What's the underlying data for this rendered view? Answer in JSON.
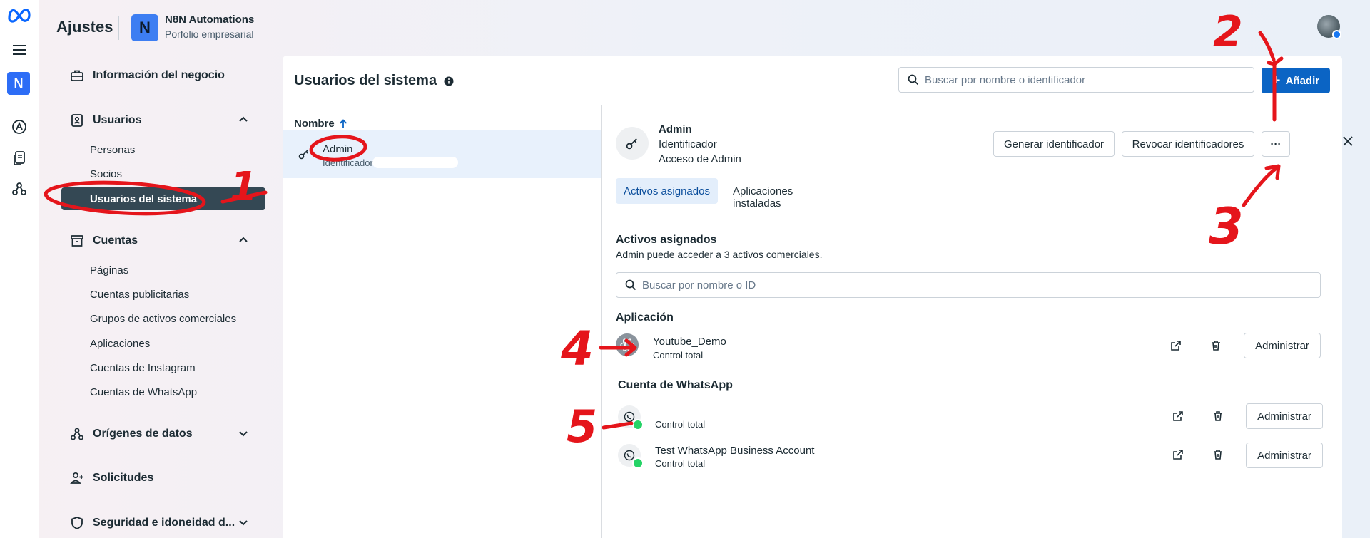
{
  "header": {
    "title": "Ajustes",
    "org_initial": "N",
    "org_name": "N8N Automations",
    "org_subtitle": "Porfolio empresarial"
  },
  "rail": {
    "org_initial": "N"
  },
  "nav": {
    "business_info": "Información del negocio",
    "users_section": "Usuarios",
    "users_items": [
      "Personas",
      "Socios",
      "Usuarios del sistema"
    ],
    "accounts_section": "Cuentas",
    "accounts_items": [
      "Páginas",
      "Cuentas publicitarias",
      "Grupos de activos comerciales",
      "Aplicaciones",
      "Cuentas de Instagram",
      "Cuentas de WhatsApp"
    ],
    "data_sources": "Orígenes de datos",
    "requests": "Solicitudes",
    "security": "Seguridad e idoneidad d..."
  },
  "main": {
    "title": "Usuarios del sistema",
    "search_placeholder": "Buscar por nombre o identificador",
    "add_label": "Añadir",
    "column_name": "Nombre",
    "list": [
      {
        "name": "Admin",
        "sub": "Identificador"
      }
    ]
  },
  "detail": {
    "name": "Admin",
    "line2": "Identificador",
    "line3": "Acceso de Admin",
    "generate_btn": "Generar identificador",
    "revoke_btn": "Revocar identificadores",
    "more_btn": "···",
    "tabs": [
      "Activos asignados",
      "Aplicaciones instaladas"
    ],
    "assets_title": "Activos asignados",
    "assets_desc": "Admin puede acceder a 3 activos comerciales.",
    "assets_search_placeholder": "Buscar por nombre o ID",
    "app_section": "Aplicación",
    "whatsapp_section": "Cuenta de WhatsApp",
    "manage_label": "Administrar",
    "assets": [
      {
        "name": "Youtube_Demo",
        "access": "Control total"
      },
      {
        "name": "",
        "access": "Control total"
      },
      {
        "name": "Test WhatsApp Business Account",
        "access": "Control total"
      }
    ]
  },
  "annotations": {
    "labels": [
      "1",
      "2",
      "3",
      "4",
      "5"
    ],
    "color": "#e5151b"
  },
  "colors": {
    "primary": "#0b64c4",
    "nav_active": "#344854",
    "selected_row": "#e8f1fc",
    "whatsapp": "#25d366"
  }
}
